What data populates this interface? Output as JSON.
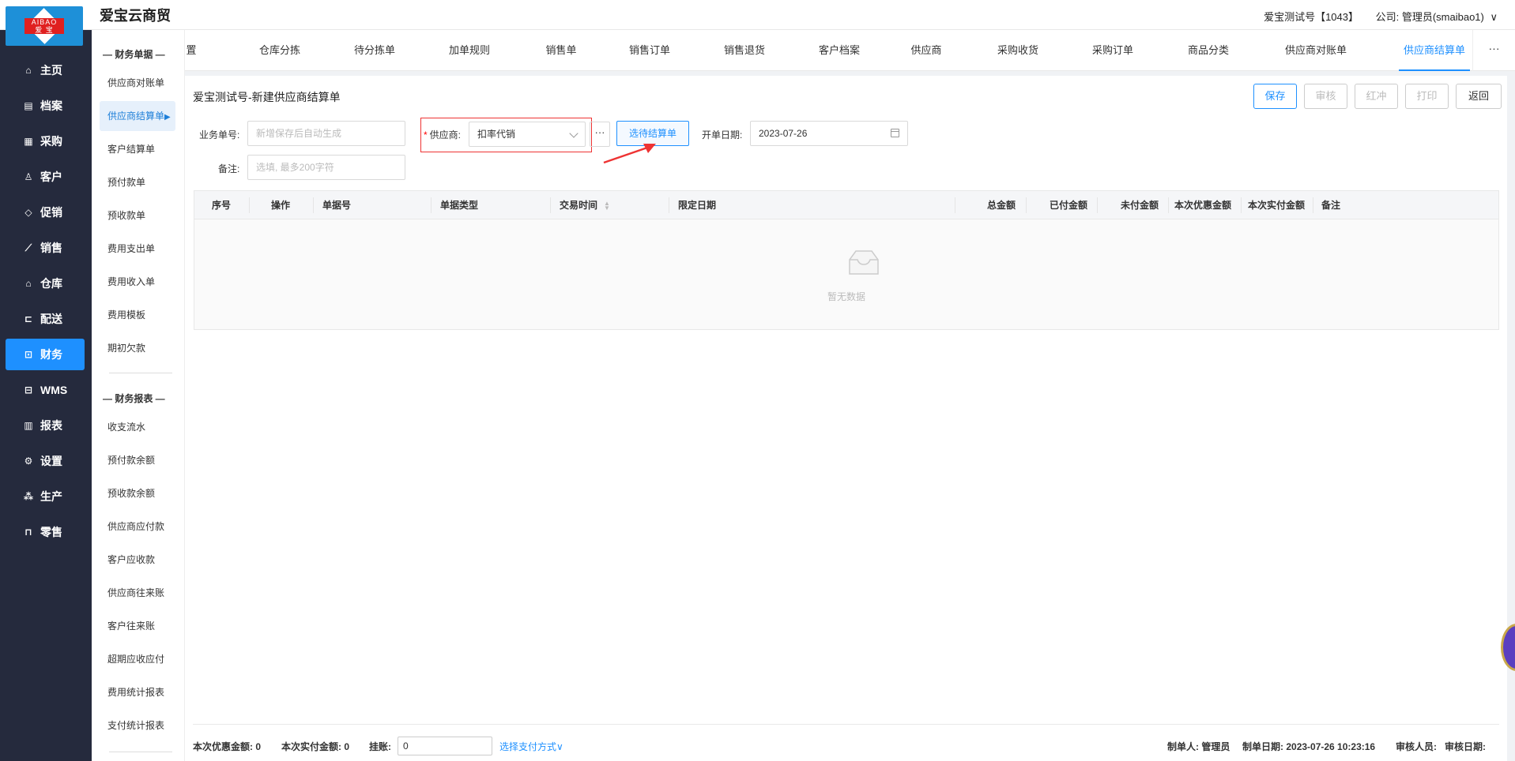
{
  "header": {
    "app_name": "爱宝云商贸",
    "account": "爱宝测试号【1043】",
    "company": "公司: 管理员(smaibao1)",
    "logo_top": "AIBAO",
    "logo_bottom": "爱 宝"
  },
  "sidebar": {
    "items": [
      {
        "label": "主页",
        "icon": "home-icon"
      },
      {
        "label": "档案",
        "icon": "archive-icon"
      },
      {
        "label": "采购",
        "icon": "purchase-icon"
      },
      {
        "label": "客户",
        "icon": "user-icon"
      },
      {
        "label": "促销",
        "icon": "promo-icon"
      },
      {
        "label": "销售",
        "icon": "chart-icon"
      },
      {
        "label": "仓库",
        "icon": "warehouse-icon"
      },
      {
        "label": "配送",
        "icon": "cart-icon"
      },
      {
        "label": "财务",
        "icon": "finance-icon",
        "active": true
      },
      {
        "label": "WMS",
        "icon": "truck-icon"
      },
      {
        "label": "报表",
        "icon": "report-icon"
      },
      {
        "label": "设置",
        "icon": "gear-icon"
      },
      {
        "label": "生产",
        "icon": "production-icon"
      },
      {
        "label": "零售",
        "icon": "bag-icon"
      }
    ]
  },
  "submenu": {
    "group1_title": "— 财务单据 —",
    "group1": [
      "供应商对账单",
      "供应商结算单",
      "客户结算单",
      "预付款单",
      "预收款单",
      "费用支出单",
      "费用收入单",
      "费用模板",
      "期初欠款"
    ],
    "group2_title": "— 财务报表 —",
    "group2": [
      "收支流水",
      "预付款余额",
      "预收款余额",
      "供应商应付款",
      "客户应收款",
      "供应商往来账",
      "客户往来账",
      "超期应收应付",
      "费用统计报表",
      "支付统计报表"
    ]
  },
  "tabs": [
    "置",
    "仓库分拣",
    "待分拣单",
    "加单规则",
    "销售单",
    "销售订单",
    "销售退货",
    "客户档案",
    "供应商",
    "采购收货",
    "采购订单",
    "商品分类",
    "供应商对账单",
    "供应商结算单"
  ],
  "tab_more": "···",
  "page": {
    "title": "爱宝测试号-新建供应商结算单",
    "buttons": {
      "save": "保存",
      "audit": "审核",
      "red": "红冲",
      "print": "打印",
      "back": "返回"
    }
  },
  "form": {
    "doc_no_label": "业务单号:",
    "doc_no_placeholder": "新增保存后自动生成",
    "supplier_label": "供应商:",
    "supplier_value": "扣率代销",
    "more": "···",
    "select_settle": "选待结算单",
    "date_label": "开单日期:",
    "date_value": "2023-07-26",
    "remark_label": "备注:",
    "remark_placeholder": "选填, 最多200字符"
  },
  "table": {
    "columns": [
      "序号",
      "操作",
      "单据号",
      "单据类型",
      "交易时间",
      "限定日期",
      "总金额",
      "已付金额",
      "未付金额",
      "本次优惠金额",
      "本次实付金额",
      "备注"
    ],
    "empty": "暂无数据"
  },
  "footer": {
    "discount_label": "本次优惠金额:",
    "discount_value": "0",
    "paid_label": "本次实付金额:",
    "paid_value": "0",
    "credit_label": "挂账:",
    "credit_value": "0",
    "pay_method": "选择支付方式",
    "maker_label": "制单人:",
    "maker_value": "管理员",
    "make_date_label": "制单日期:",
    "make_date_value": "2023-07-26 10:23:16",
    "auditor_label": "审核人员:",
    "audit_date_label": "审核日期:"
  }
}
